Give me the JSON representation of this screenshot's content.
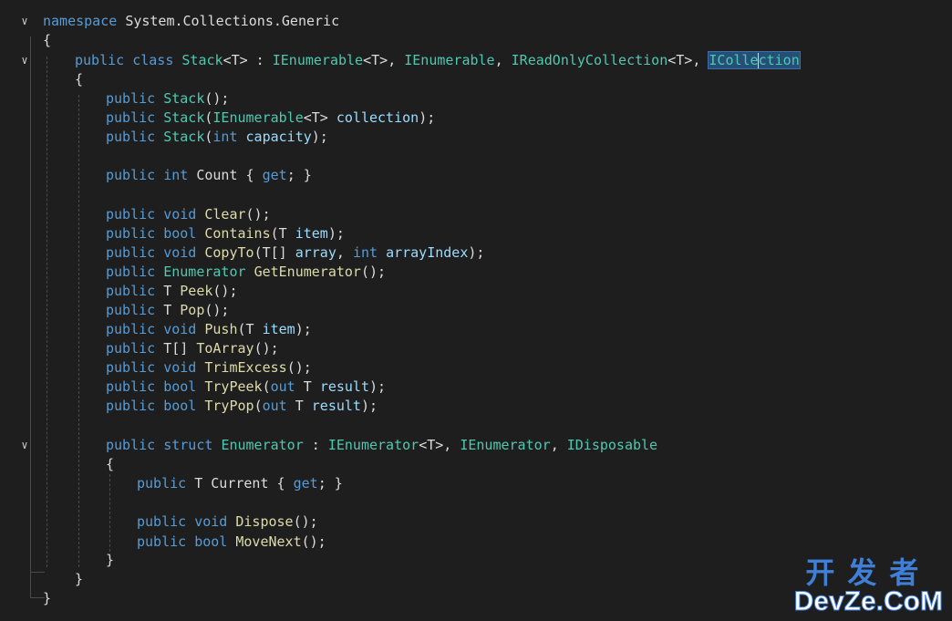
{
  "code": {
    "ns_kw": "namespace",
    "ns_name": "System.Collections.Generic",
    "brace_open": "{",
    "brace_close": "}",
    "public": "public",
    "class_kw": "class",
    "class_name": "Stack",
    "gen_T": "<T>",
    "colon": " : ",
    "comma": ", ",
    "i_enumerable": "IEnumerable",
    "i_readonly_collection": "IReadOnlyCollection",
    "i_collection_sel": "IColle",
    "i_collection_rest": "ction",
    "paren_semi": "();",
    "paren_open": "(",
    "paren_close_semi": ");",
    "collection_param": "collection",
    "int": "int",
    "capacity_param": "capacity",
    "count_prop": "Count",
    "get_open": " { ",
    "get_kw": "get",
    "get_close": "; }",
    "void": "void",
    "bool": "bool",
    "clear": "Clear",
    "contains": "Contains",
    "T": "T",
    "item": "item",
    "copy_to": "CopyTo",
    "T_arr": "T[]",
    "array_param": "array",
    "array_index_param": "arrayIndex",
    "enumerator": "Enumerator",
    "get_enumerator": "GetEnumerator",
    "peek": "Peek",
    "pop": "Pop",
    "push": "Push",
    "to_array": "ToArray",
    "trim_excess": "TrimExcess",
    "try_peek": "TryPeek",
    "try_pop": "TryPop",
    "out": "out",
    "result": "result",
    "struct_kw": "struct",
    "i_enumerator": "IEnumerator",
    "i_disposable": "IDisposable",
    "current": "Current",
    "dispose": "Dispose",
    "move_next": "MoveNext"
  },
  "watermark": {
    "cn": "开发者",
    "en": "DevZe.CoM"
  },
  "colors": {
    "background": "#1e1e1e",
    "keyword": "#569cd6",
    "type": "#4ec9b0",
    "method": "#dcdcaa",
    "parameter": "#9cdcfe",
    "plain": "#dcdcdc",
    "selection": "#264f78"
  },
  "icons": {
    "fold": "chevron-down-icon"
  }
}
